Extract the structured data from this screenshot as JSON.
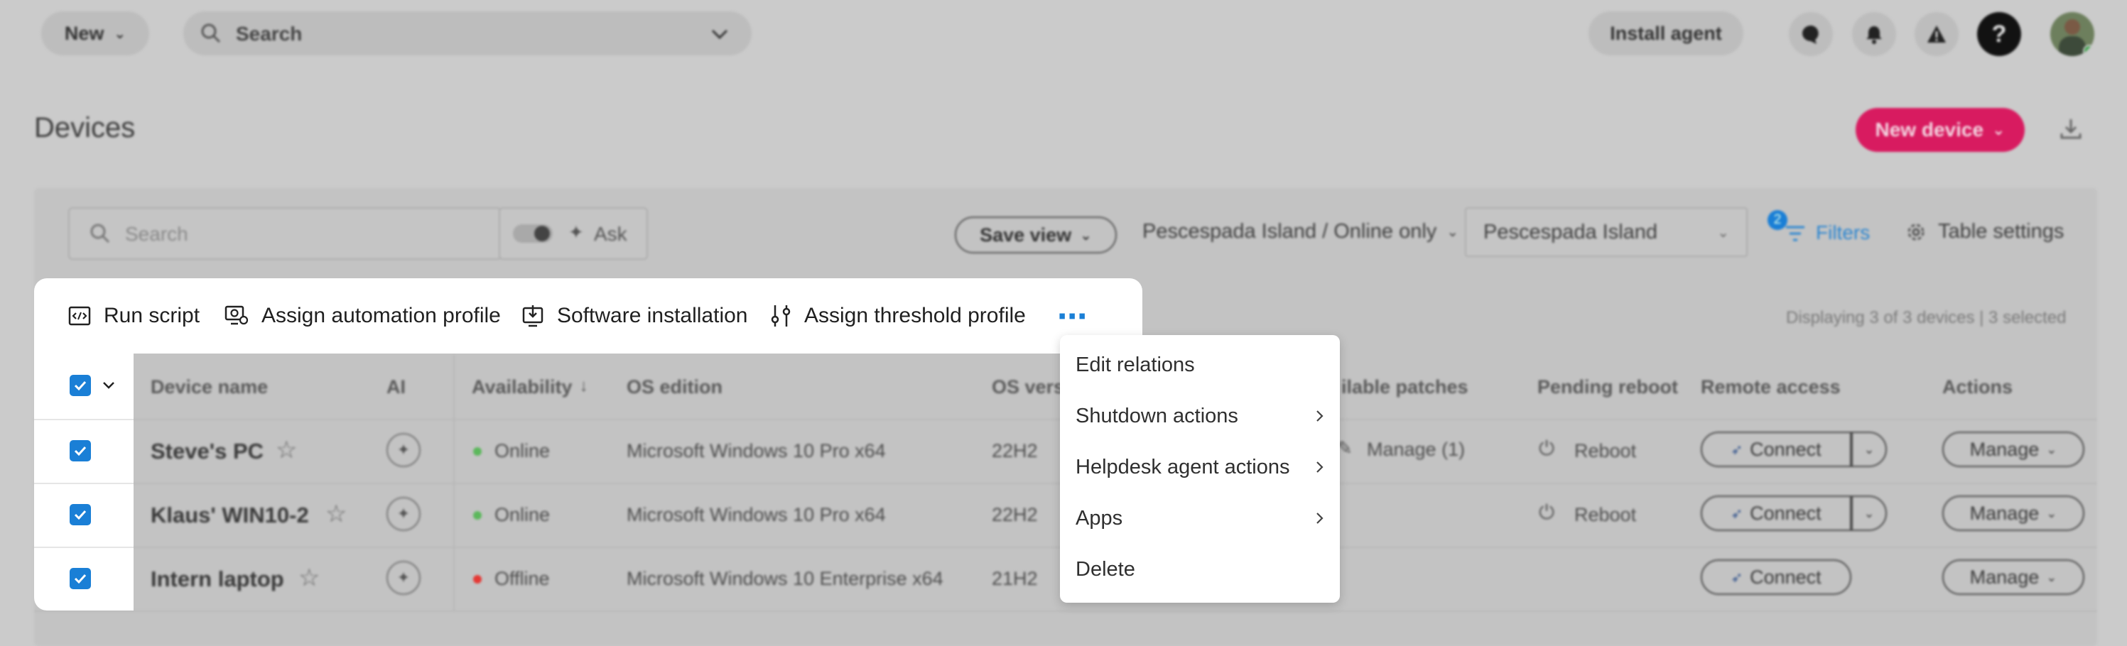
{
  "topbar": {
    "new_label": "New",
    "search_placeholder": "Search",
    "install_agent_label": "Install agent",
    "icons": [
      "chat-icon",
      "bell-icon",
      "alert-icon",
      "help-icon",
      "avatar"
    ]
  },
  "page": {
    "title": "Devices",
    "new_device_label": "New device"
  },
  "toolbar": {
    "search_placeholder": "Search",
    "ask_label": "Ask",
    "save_view_label": "Save view",
    "view_selector": "Pescespada Island / Online only",
    "org_selector": "Pescespada Island",
    "filters_label": "Filters",
    "filters_count": "2",
    "table_settings_label": "Table settings",
    "status_text": "Displaying 3 of 3 devices | 3 selected"
  },
  "bulk_actions": {
    "run_script": "Run script",
    "assign_automation": "Assign automation profile",
    "software_installation": "Software installation",
    "assign_threshold": "Assign threshold profile",
    "more": "⋯"
  },
  "table": {
    "headers": {
      "device_name": "Device name",
      "ai": "AI",
      "availability": "Availability",
      "os_edition": "OS edition",
      "os_version": "OS vers",
      "available_patches": "ilable patches",
      "pending_reboot": "Pending reboot",
      "remote_access": "Remote access",
      "actions": "Actions"
    },
    "rows": [
      {
        "name": "Steve's PC",
        "availability": "Online",
        "os": "Microsoft Windows 10 Pro x64",
        "version": "22H2",
        "patches": "Manage (1)",
        "reboot": "Reboot",
        "remote": "Connect",
        "action": "Manage"
      },
      {
        "name": "Klaus' WIN10-2",
        "availability": "Online",
        "os": "Microsoft Windows 10 Pro x64",
        "version": "22H2",
        "patches": "",
        "reboot": "Reboot",
        "remote": "Connect",
        "action": "Manage"
      },
      {
        "name": "Intern laptop",
        "availability": "Offline",
        "os": "Microsoft Windows 10 Enterprise x64",
        "version": "21H2",
        "patches": "",
        "reboot": "",
        "remote": "Connect",
        "action": "Manage"
      }
    ]
  },
  "menu": {
    "items": [
      "Edit relations",
      "Shutdown actions",
      "Helpdesk agent actions",
      "Apps",
      "Delete"
    ]
  },
  "colors": {
    "accent": "#d81b60",
    "checkbox": "#1a7fd6",
    "online": "#5cb85c",
    "offline": "#e53935"
  }
}
